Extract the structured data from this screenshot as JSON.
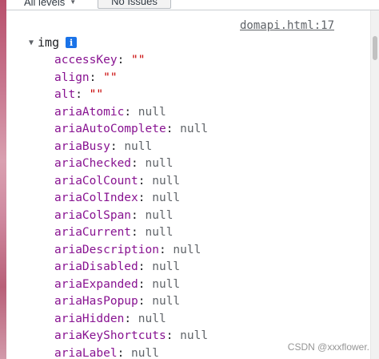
{
  "toolbar": {
    "levels_label": "All levels",
    "levels_caret": "▼",
    "issues_label": "No Issues"
  },
  "console": {
    "source_link": "domapi.html:17",
    "object": {
      "expand_glyph": "▼",
      "tag": "img",
      "info_icon": "i",
      "properties": [
        {
          "key": "accessKey",
          "value": "\"\"",
          "type": "string"
        },
        {
          "key": "align",
          "value": "\"\"",
          "type": "string"
        },
        {
          "key": "alt",
          "value": "\"\"",
          "type": "string"
        },
        {
          "key": "ariaAtomic",
          "value": "null",
          "type": "null"
        },
        {
          "key": "ariaAutoComplete",
          "value": "null",
          "type": "null"
        },
        {
          "key": "ariaBusy",
          "value": "null",
          "type": "null"
        },
        {
          "key": "ariaChecked",
          "value": "null",
          "type": "null"
        },
        {
          "key": "ariaColCount",
          "value": "null",
          "type": "null"
        },
        {
          "key": "ariaColIndex",
          "value": "null",
          "type": "null"
        },
        {
          "key": "ariaColSpan",
          "value": "null",
          "type": "null"
        },
        {
          "key": "ariaCurrent",
          "value": "null",
          "type": "null"
        },
        {
          "key": "ariaDescription",
          "value": "null",
          "type": "null"
        },
        {
          "key": "ariaDisabled",
          "value": "null",
          "type": "null"
        },
        {
          "key": "ariaExpanded",
          "value": "null",
          "type": "null"
        },
        {
          "key": "ariaHasPopup",
          "value": "null",
          "type": "null"
        },
        {
          "key": "ariaHidden",
          "value": "null",
          "type": "null"
        },
        {
          "key": "ariaKeyShortcuts",
          "value": "null",
          "type": "null"
        },
        {
          "key": "ariaLabel",
          "value": "null",
          "type": "null"
        }
      ]
    }
  },
  "watermark": "CSDN @xxxflower.",
  "colors": {
    "key": "#881391",
    "string": "#c80000",
    "null": "#5f6368",
    "link": "#5f6368",
    "info_badge": "#1a73e8"
  }
}
